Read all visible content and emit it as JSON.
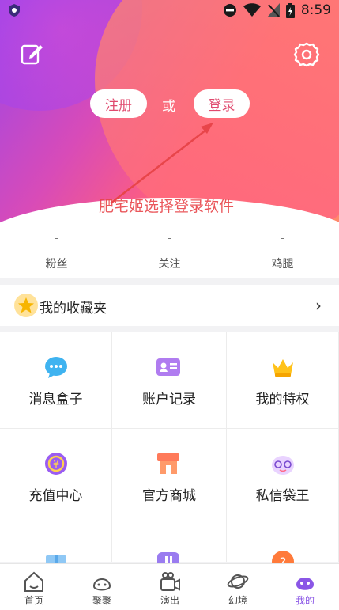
{
  "status_bar": {
    "time": "8:59"
  },
  "header": {
    "register_label": "注册",
    "or_label": "或",
    "login_label": "登录",
    "annotation_text": "肥宅姬选择登录软件"
  },
  "stats": [
    {
      "value": "-",
      "label": "粉丝"
    },
    {
      "value": "-",
      "label": "关注"
    },
    {
      "value": "-",
      "label": "鸡腿"
    }
  ],
  "favorites": {
    "label": "我的收藏夹",
    "chevron": "›"
  },
  "grid": [
    {
      "label": "消息盒子",
      "icon": "message-bubble-icon"
    },
    {
      "label": "账户记录",
      "icon": "id-card-icon"
    },
    {
      "label": "我的特权",
      "icon": "crown-icon"
    },
    {
      "label": "充值中心",
      "icon": "coin-icon"
    },
    {
      "label": "官方商城",
      "icon": "shop-icon"
    },
    {
      "label": "私信袋王",
      "icon": "mascot-icon"
    },
    {
      "label": "",
      "icon": "gift-icon"
    },
    {
      "label": "",
      "icon": "music-icon"
    },
    {
      "label": "",
      "icon": "help-icon"
    }
  ],
  "nav": [
    {
      "label": "首页",
      "icon": "home-icon"
    },
    {
      "label": "聚聚",
      "icon": "group-icon"
    },
    {
      "label": "演出",
      "icon": "camera-icon"
    },
    {
      "label": "幻境",
      "icon": "planet-icon"
    },
    {
      "label": "我的",
      "icon": "profile-icon",
      "active": true
    }
  ],
  "colors": {
    "accent": "#8a56e6",
    "brand_pink": "#e04a6e",
    "annotation_red": "#e8454a"
  }
}
